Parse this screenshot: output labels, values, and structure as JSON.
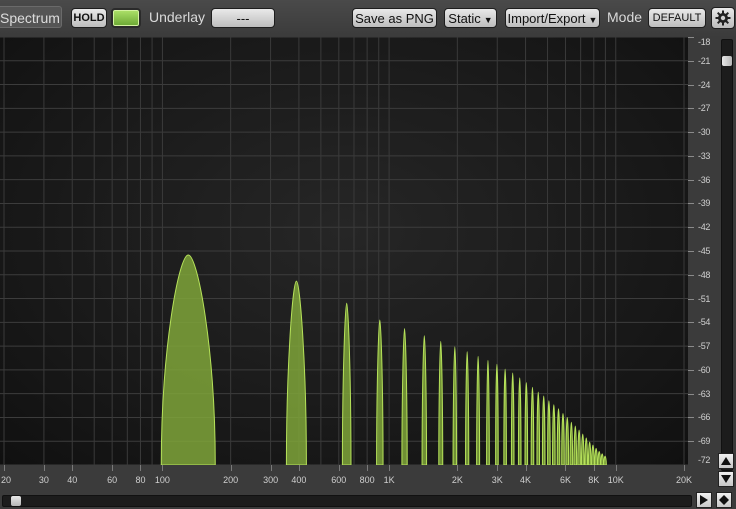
{
  "toolbar": {
    "title": "Spectrum",
    "hold_label": "HOLD",
    "underlay_label": "Underlay",
    "underlay_value": "---",
    "save_label": "Save as PNG",
    "static_label": "Static",
    "import_export_label": "Import/Export",
    "mode_label": "Mode",
    "mode_value": "DEFAULT",
    "hold_led_color": "#8fcc4a",
    "settings_icon": "gear-icon"
  },
  "chart_data": {
    "type": "area",
    "title": "",
    "xlabel": "",
    "ylabel": "",
    "x_scale": "log",
    "xlim": [
      20,
      20000
    ],
    "ylim": [
      -72,
      -18
    ],
    "grid": true,
    "fill_color": "#7fa53a",
    "edge_color": "#b6e25a",
    "x_ticks": [
      {
        "value": 20,
        "label": "20"
      },
      {
        "value": 30,
        "label": "30"
      },
      {
        "value": 40,
        "label": "40"
      },
      {
        "value": 60,
        "label": "60"
      },
      {
        "value": 80,
        "label": "80"
      },
      {
        "value": 100,
        "label": "100"
      },
      {
        "value": 200,
        "label": "200"
      },
      {
        "value": 300,
        "label": "300"
      },
      {
        "value": 400,
        "label": "400"
      },
      {
        "value": 600,
        "label": "600"
      },
      {
        "value": 800,
        "label": "800"
      },
      {
        "value": 1000,
        "label": "1K"
      },
      {
        "value": 2000,
        "label": "2K"
      },
      {
        "value": 3000,
        "label": "3K"
      },
      {
        "value": 4000,
        "label": "4K"
      },
      {
        "value": 6000,
        "label": "6K"
      },
      {
        "value": 8000,
        "label": "8K"
      },
      {
        "value": 10000,
        "label": "10K"
      },
      {
        "value": 20000,
        "label": "20K"
      }
    ],
    "y_ticks": [
      {
        "value": -18,
        "label": "-18"
      },
      {
        "value": -21,
        "label": "-21"
      },
      {
        "value": -24,
        "label": "-24"
      },
      {
        "value": -27,
        "label": "-27"
      },
      {
        "value": -30,
        "label": "-30"
      },
      {
        "value": -33,
        "label": "-33"
      },
      {
        "value": -36,
        "label": "-36"
      },
      {
        "value": -39,
        "label": "-39"
      },
      {
        "value": -42,
        "label": "-42"
      },
      {
        "value": -45,
        "label": "-45"
      },
      {
        "value": -48,
        "label": "-48"
      },
      {
        "value": -51,
        "label": "-51"
      },
      {
        "value": -54,
        "label": "-54"
      },
      {
        "value": -57,
        "label": "-57"
      },
      {
        "value": -60,
        "label": "-60"
      },
      {
        "value": -63,
        "label": "-63"
      },
      {
        "value": -66,
        "label": "-66"
      },
      {
        "value": -69,
        "label": "-69"
      },
      {
        "value": -72,
        "label": "-72"
      }
    ],
    "peaks": [
      {
        "freq": 130,
        "db": -45.5
      },
      {
        "freq": 390,
        "db": -48.8
      },
      {
        "freq": 650,
        "db": -51.6
      },
      {
        "freq": 910,
        "db": -53.7
      },
      {
        "freq": 1170,
        "db": -54.8
      },
      {
        "freq": 1430,
        "db": -55.7
      },
      {
        "freq": 1690,
        "db": -56.4
      },
      {
        "freq": 1950,
        "db": -57.1
      },
      {
        "freq": 2210,
        "db": -57.7
      },
      {
        "freq": 2470,
        "db": -58.3
      },
      {
        "freq": 2730,
        "db": -58.8
      },
      {
        "freq": 2990,
        "db": -59.3
      },
      {
        "freq": 3250,
        "db": -59.9
      },
      {
        "freq": 3510,
        "db": -60.4
      },
      {
        "freq": 3770,
        "db": -61.0
      },
      {
        "freq": 4030,
        "db": -61.6
      },
      {
        "freq": 4290,
        "db": -62.2
      },
      {
        "freq": 4550,
        "db": -62.8
      },
      {
        "freq": 4810,
        "db": -63.3
      },
      {
        "freq": 5070,
        "db": -63.9
      },
      {
        "freq": 5330,
        "db": -64.4
      },
      {
        "freq": 5590,
        "db": -64.9
      },
      {
        "freq": 5850,
        "db": -65.5
      },
      {
        "freq": 6110,
        "db": -66.0
      },
      {
        "freq": 6370,
        "db": -66.6
      },
      {
        "freq": 6630,
        "db": -67.1
      },
      {
        "freq": 6890,
        "db": -67.6
      },
      {
        "freq": 7150,
        "db": -68.1
      },
      {
        "freq": 7410,
        "db": -68.6
      },
      {
        "freq": 7670,
        "db": -69.1
      },
      {
        "freq": 7930,
        "db": -69.5
      },
      {
        "freq": 8190,
        "db": -69.9
      },
      {
        "freq": 8450,
        "db": -70.3
      },
      {
        "freq": 8710,
        "db": -70.6
      },
      {
        "freq": 8970,
        "db": -70.9
      }
    ]
  }
}
